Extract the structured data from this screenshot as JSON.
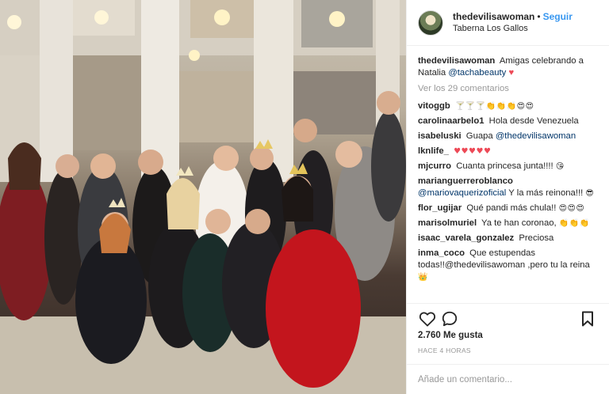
{
  "header": {
    "username": "thedevilisawoman",
    "separator": "•",
    "follow_label": "Seguir",
    "location": "Taberna Los Gallos"
  },
  "caption": {
    "user": "thedevilisawoman",
    "text": "Amigas celebrando a Natalia",
    "mention": "@tachabeauty",
    "emoji": "♥"
  },
  "view_more": "Ver los 29 comentarios",
  "comments": [
    {
      "user": "vitoggb",
      "text": "",
      "emoji": "🍸🍸🍸👏👏👏😍😍"
    },
    {
      "user": "carolinaarbelo1",
      "text": "Hola desde Venezuela",
      "emoji": ""
    },
    {
      "user": "isabeluski",
      "text": "Guapa",
      "mention": "@thedevilisawoman",
      "emoji": ""
    },
    {
      "user": "lknlife_",
      "text": "",
      "emoji": "♥♥♥♥♥"
    },
    {
      "user": "mjcurro",
      "text": "Cuanta princesa junta!!!!",
      "emoji": "😘"
    },
    {
      "user": "marianguerreroblanco",
      "text": "",
      "mention": "@mariovaquerizoficial",
      "text_after": "Y la más reinona!!!",
      "emoji": "😎"
    },
    {
      "user": "flor_ugijar",
      "text": "Qué pandi más chula!!",
      "emoji": "😍😍😍"
    },
    {
      "user": "marisolmuriel",
      "text": "Ya te han coronao,",
      "emoji": "👏👏👏"
    },
    {
      "user": "isaac_varela_gonzalez",
      "text": "Preciosa",
      "emoji": ""
    },
    {
      "user": "inma_coco",
      "text": "Que estupendas todas!!@thedevilisawoman ,pero tu la reina",
      "emoji": "👑"
    }
  ],
  "icons": {
    "like": "heart-icon",
    "comment": "speech-bubble-icon",
    "save": "bookmark-icon"
  },
  "likes": "2.760 Me gusta",
  "timestamp": "HACE 4 HORAS",
  "add_comment_placeholder": "Añade un comentario...",
  "colors": {
    "link": "#3897f0",
    "mention": "#003569",
    "muted": "#999999",
    "caption_heart": "#ed4956"
  }
}
